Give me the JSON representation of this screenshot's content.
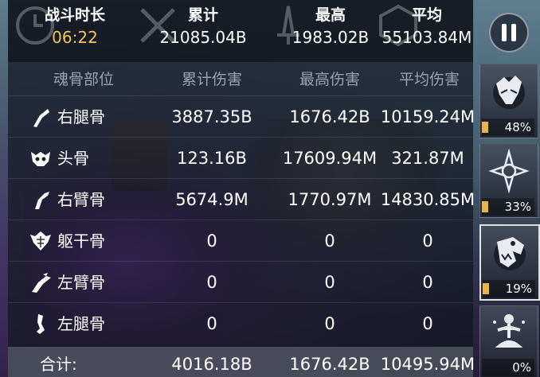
{
  "summary": {
    "duration": {
      "label": "战斗时长",
      "value": "06:22",
      "icon": "clock-icon"
    },
    "total": {
      "label": "累计",
      "value": "21085.04B",
      "icon": "crossed-swords-icon"
    },
    "max": {
      "label": "最高",
      "value": "1983.02B",
      "icon": "sword-icon"
    },
    "average": {
      "label": "平均",
      "value": "55103.84M",
      "icon": "hexagon-icon"
    }
  },
  "columns": {
    "part": "魂骨部位",
    "total": "累计伤害",
    "max": "最高伤害",
    "average": "平均伤害"
  },
  "rows": [
    {
      "icon": "right-leg-bone-icon",
      "name": "右腿骨",
      "total": "3887.35B",
      "max": "1676.42B",
      "average": "10159.24M"
    },
    {
      "icon": "skull-icon",
      "name": "头骨",
      "total": "123.16B",
      "max": "17609.94M",
      "average": "321.87M"
    },
    {
      "icon": "right-arm-bone-icon",
      "name": "右臂骨",
      "total": "5674.9M",
      "max": "1770.97M",
      "average": "14830.85M"
    },
    {
      "icon": "torso-bone-icon",
      "name": "躯干骨",
      "total": "0",
      "max": "0",
      "average": "0"
    },
    {
      "icon": "left-arm-bone-icon",
      "name": "左臂骨",
      "total": "0",
      "max": "0",
      "average": "0"
    },
    {
      "icon": "left-leg-bone-icon",
      "name": "左腿骨",
      "total": "0",
      "max": "0",
      "average": "0"
    }
  ],
  "totals": {
    "label": "合计:",
    "total": "4016.18B",
    "max": "1676.42B",
    "average": "10495.94M"
  },
  "pause_icon": "pause-icon",
  "side_cards": [
    {
      "icon": "dragon-spirit-icon",
      "percent_label": "48%",
      "percent": 48,
      "selected": false
    },
    {
      "icon": "star-emblem-icon",
      "percent_label": "33%",
      "percent": 33,
      "selected": false
    },
    {
      "icon": "serpent-skull-icon",
      "percent_label": "19%",
      "percent": 19,
      "selected": true
    },
    {
      "icon": "meditating-figure-icon",
      "percent_label": "0%",
      "percent": 0,
      "selected": false
    }
  ],
  "colors": {
    "accent_gold": "#f3c35a",
    "bar_gold": "#e7b54b"
  }
}
